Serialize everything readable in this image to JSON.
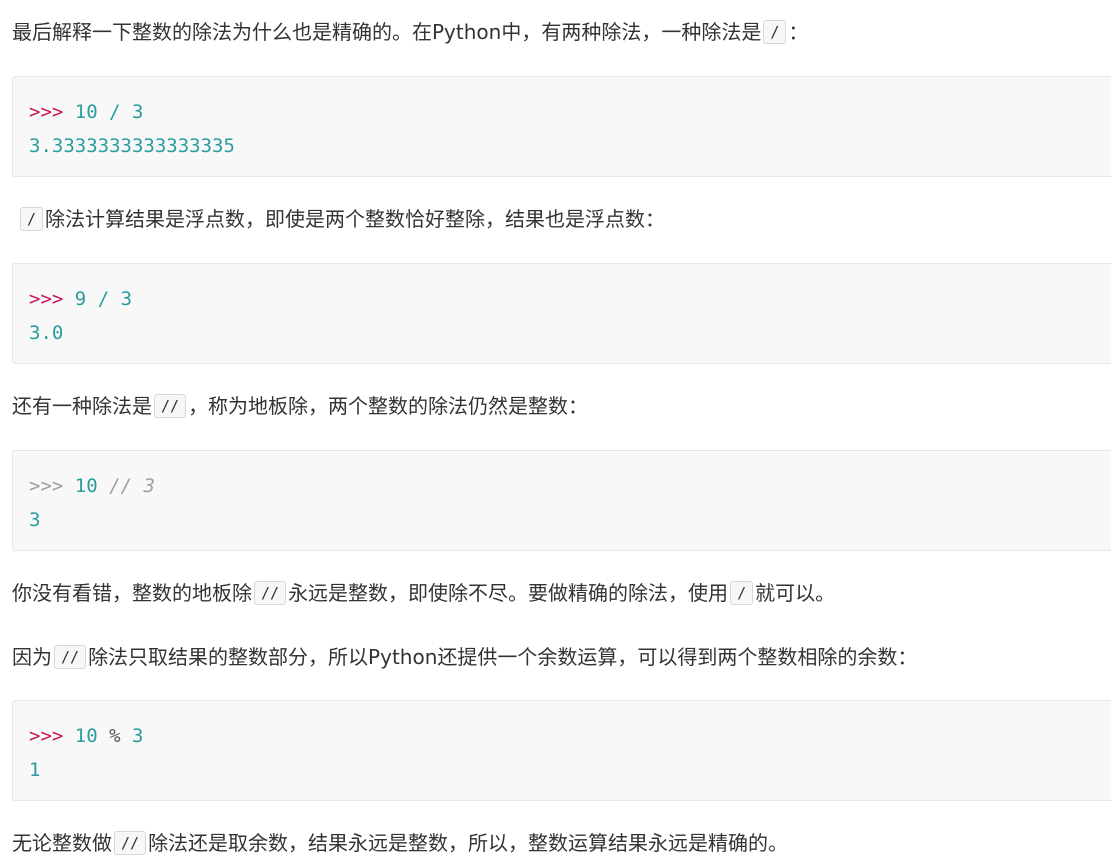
{
  "paragraphs": {
    "p1": {
      "text": "最后解释一下整数的除法为什么也是精确的。在Python中，有两种除法，一种除法是",
      "code": "/",
      "tail": "："
    },
    "p2": {
      "code": "/",
      "text": "除法计算结果是浮点数，即使是两个整数恰好整除，结果也是浮点数："
    },
    "p3": {
      "text": "还有一种除法是",
      "code": "//",
      "tail": "，称为地板除，两个整数的除法仍然是整数："
    },
    "p4": {
      "text1": "你没有看错，整数的地板除",
      "code1": "//",
      "text2": "永远是整数，即使除不尽。要做精确的除法，使用",
      "code2": "/",
      "text3": "就可以。"
    },
    "p5": {
      "text1": "因为",
      "code1": "//",
      "text2": "除法只取结果的整数部分，所以Python还提供一个余数运算，可以得到两个整数相除的余数："
    },
    "p6": {
      "text1": "无论整数做",
      "code1": "//",
      "text2": "除法还是取余数，结果永远是整数，所以，整数运算结果永远是精确的。"
    }
  },
  "code_blocks": {
    "b1": {
      "prompt": ">>>",
      "a": "10",
      "op": "/",
      "b": "3",
      "output": "3.3333333333333335"
    },
    "b2": {
      "prompt": ">>>",
      "a": "9",
      "op": "/",
      "b": "3",
      "output": "3.0"
    },
    "b3": {
      "prompt": ">>>",
      "a": "10",
      "comment": "// 3",
      "output": "3"
    },
    "b4": {
      "prompt": ">>>",
      "a": "10",
      "op": "%",
      "b": "3",
      "output": "1"
    }
  }
}
